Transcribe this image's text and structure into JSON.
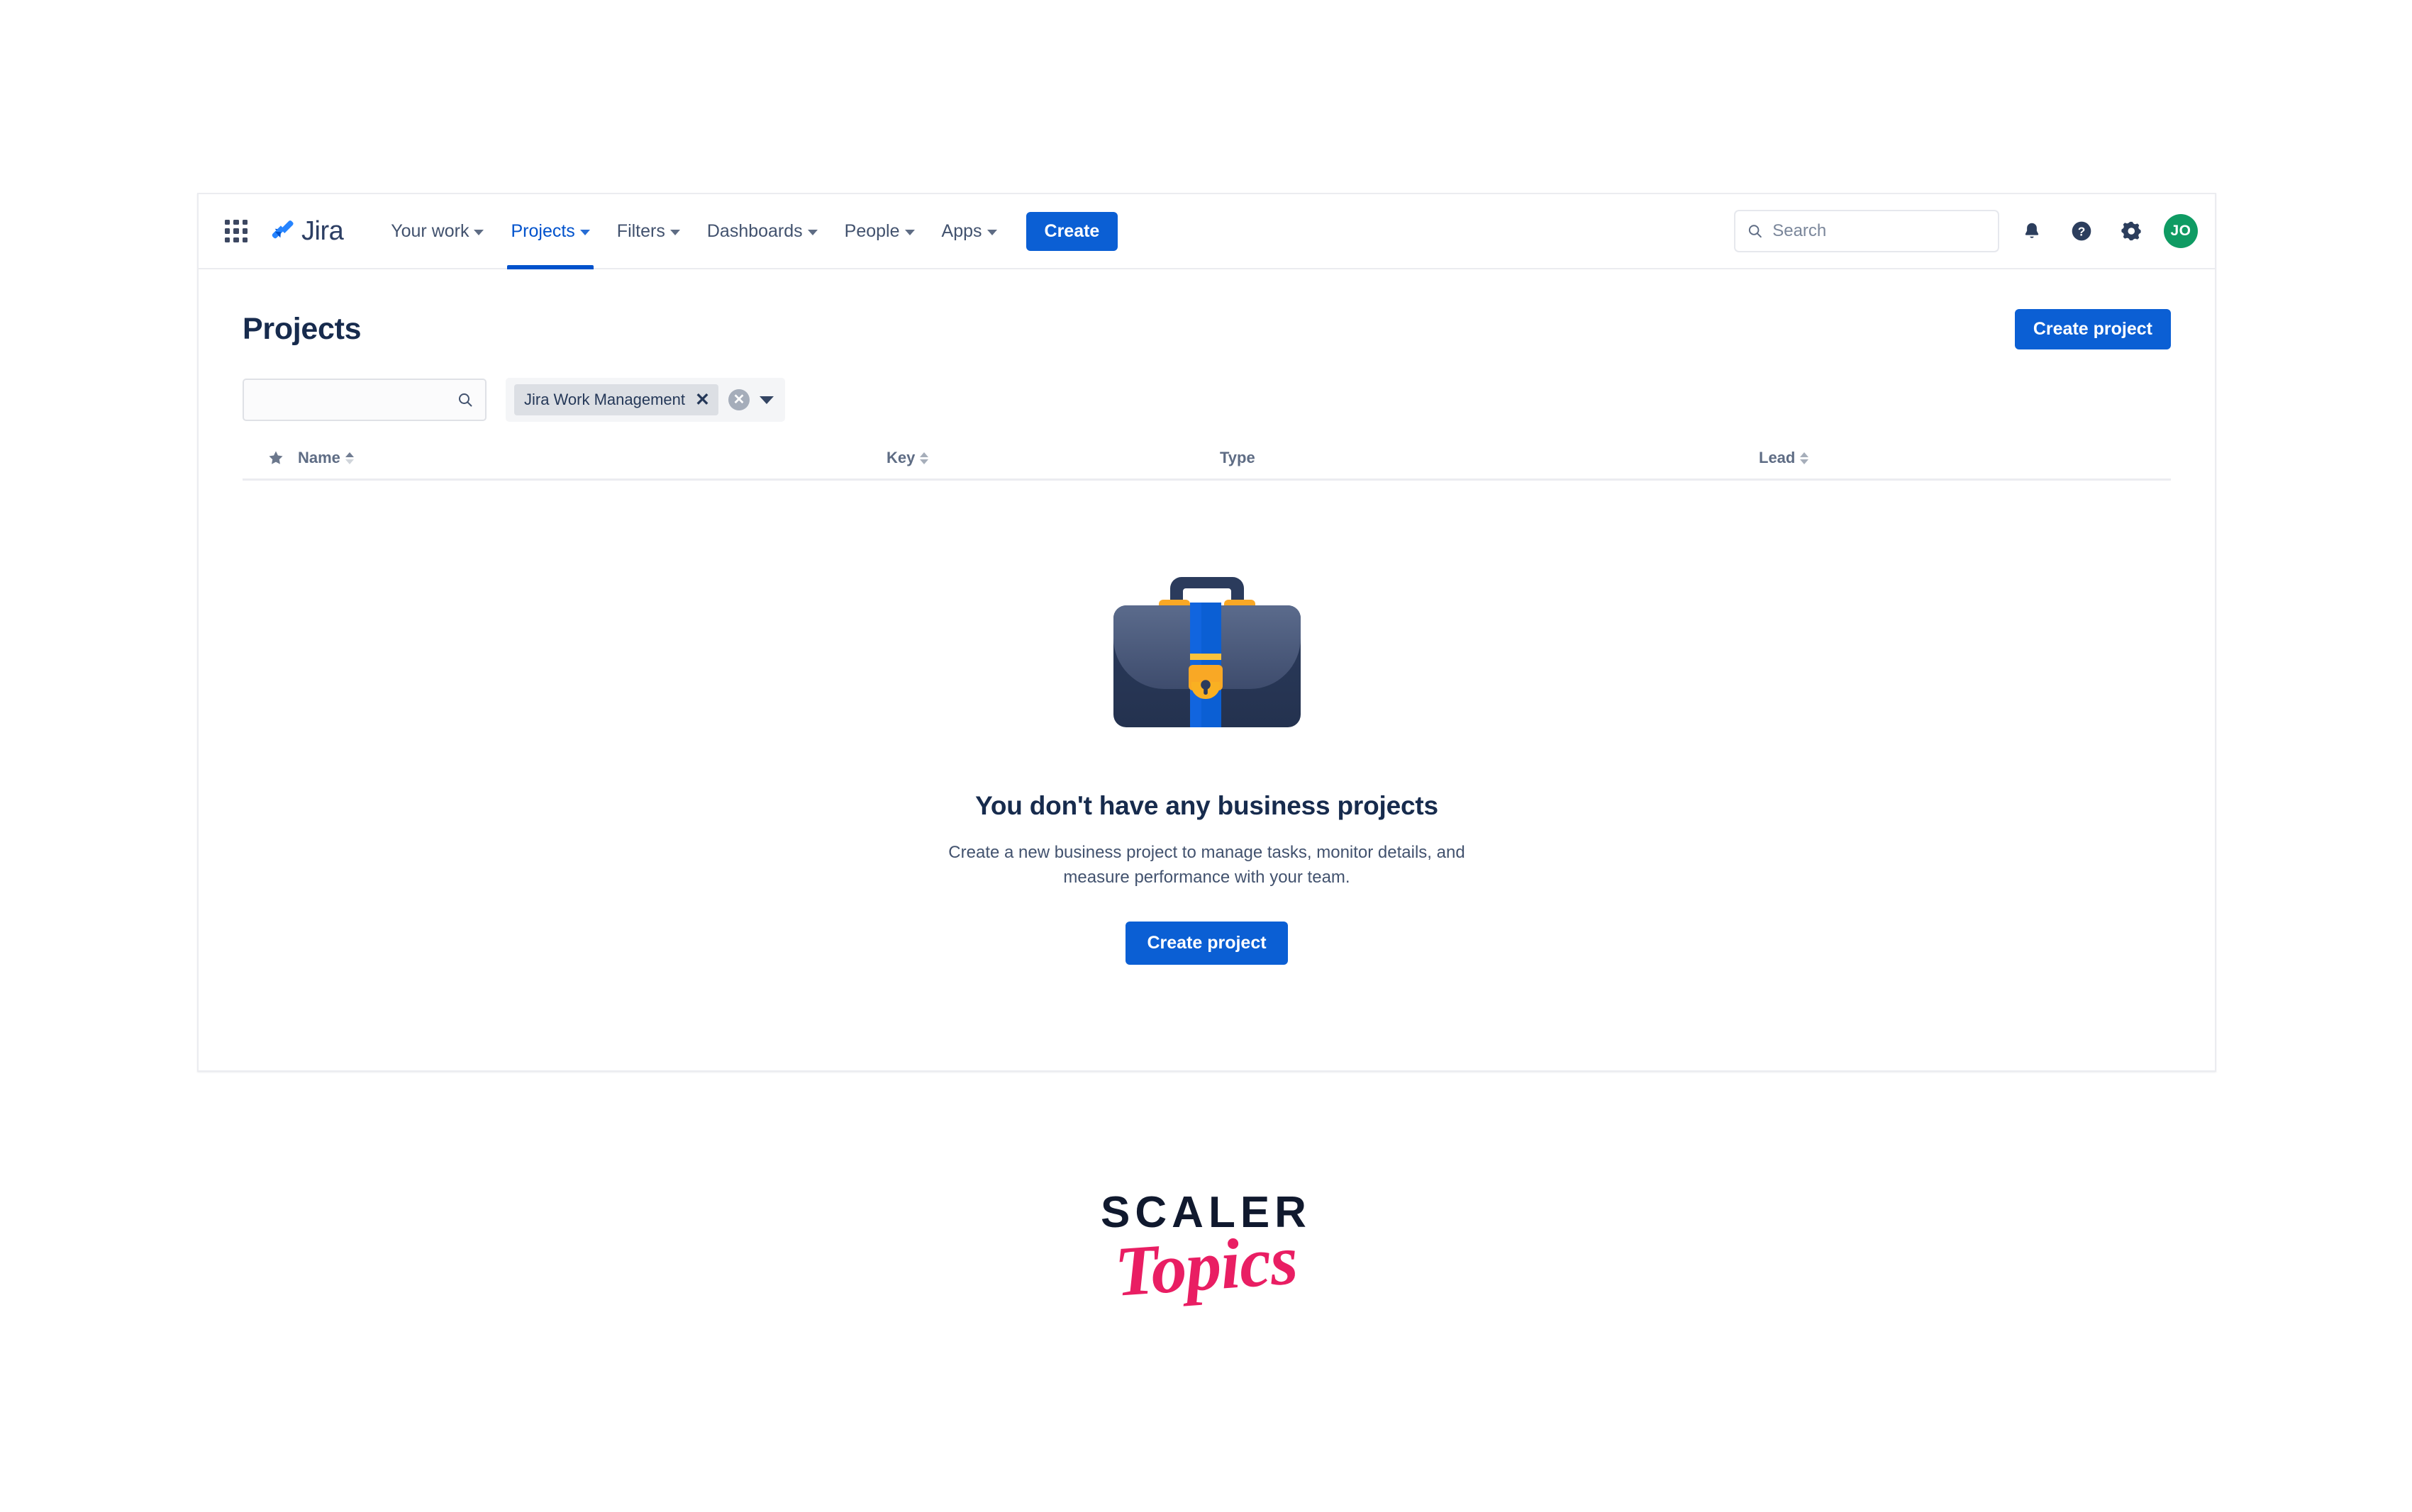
{
  "nav": {
    "app_switcher_icon": "grid-apps-icon",
    "brand_icon": "jira-logo-icon",
    "brand_name": "Jira",
    "items": [
      {
        "label": "Your work",
        "has_dropdown": true,
        "active": false
      },
      {
        "label": "Projects",
        "has_dropdown": true,
        "active": true
      },
      {
        "label": "Filters",
        "has_dropdown": true,
        "active": false
      },
      {
        "label": "Dashboards",
        "has_dropdown": true,
        "active": false
      },
      {
        "label": "People",
        "has_dropdown": true,
        "active": false
      },
      {
        "label": "Apps",
        "has_dropdown": true,
        "active": false
      }
    ],
    "create_label": "Create",
    "search": {
      "placeholder": "Search",
      "value": "",
      "icon": "search-icon"
    },
    "notifications_icon": "bell-icon",
    "help_icon": "help-circle-icon",
    "settings_icon": "gear-icon",
    "avatar_initials": "JO"
  },
  "page": {
    "title": "Projects",
    "create_project_label": "Create project"
  },
  "filters": {
    "search": {
      "placeholder": "",
      "value": "",
      "icon": "search-icon"
    },
    "chip_label": "Jira Work Management",
    "chip_remove_icon": "close-x-icon",
    "clear_all_icon": "clear-circle-icon",
    "dropdown_icon": "chevron-down-icon"
  },
  "table": {
    "columns": [
      {
        "key": "star",
        "label": "",
        "icon": "star-icon",
        "sort": "none"
      },
      {
        "key": "name",
        "label": "Name",
        "sort": "asc"
      },
      {
        "key": "key",
        "label": "Key",
        "sort": "none"
      },
      {
        "key": "type",
        "label": "Type",
        "sort": "none"
      },
      {
        "key": "lead",
        "label": "Lead",
        "sort": "none"
      }
    ],
    "rows": []
  },
  "empty_state": {
    "illustration": "briefcase-icon",
    "title": "You don't have any business projects",
    "description": "Create a new business project to manage tasks, monitor details, and measure performance with your team.",
    "cta_label": "Create project"
  },
  "watermark": {
    "primary": "SCALER",
    "secondary": "Topics"
  },
  "colors": {
    "brand_blue": "#0b5fd4",
    "link_blue": "#0052cc",
    "text_dark": "#172b4d",
    "text_muted": "#5e6c84",
    "avatar_green": "#0f9b63",
    "accent_pink": "#e91e63"
  }
}
